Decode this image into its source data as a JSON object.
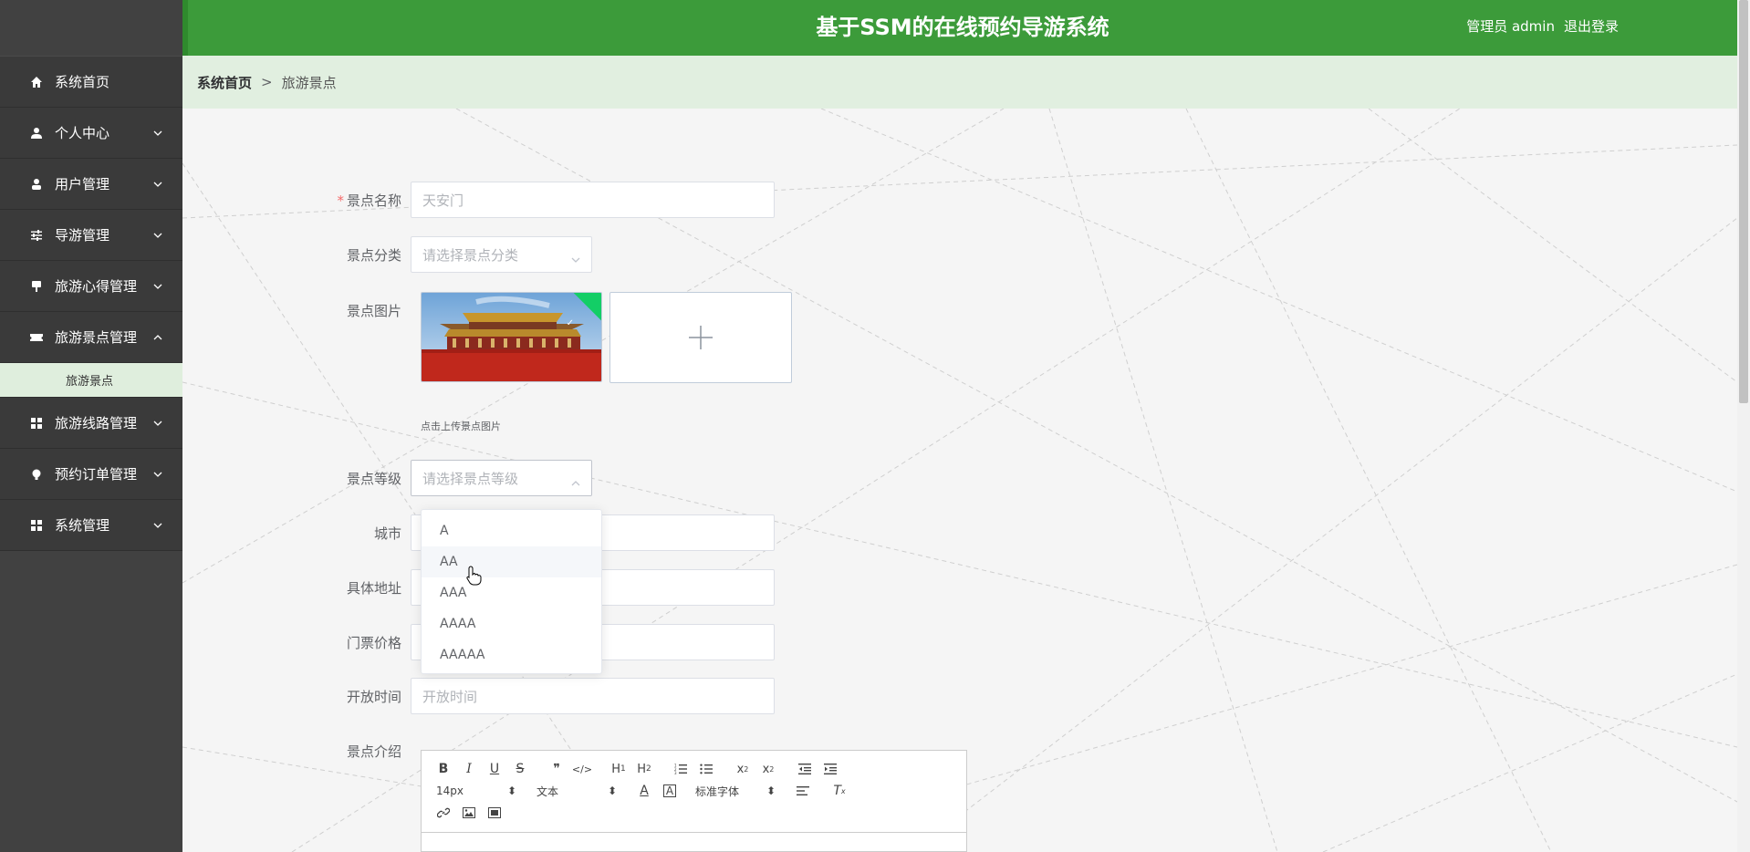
{
  "header": {
    "title": "基于SSM的在线预约导游系统",
    "user_label": "管理员 admin",
    "logout_label": "退出登录"
  },
  "sidebar": {
    "items": [
      {
        "label": "系统首页",
        "icon": "home-icon",
        "expandable": false
      },
      {
        "label": "个人中心",
        "icon": "user-icon",
        "expandable": true
      },
      {
        "label": "用户管理",
        "icon": "user-manage-icon",
        "expandable": true
      },
      {
        "label": "导游管理",
        "icon": "sliders-icon",
        "expandable": true
      },
      {
        "label": "旅游心得管理",
        "icon": "sign-icon",
        "expandable": true
      },
      {
        "label": "旅游景点管理",
        "icon": "ticket-icon",
        "expandable": true,
        "expanded": true
      },
      {
        "label": "旅游线路管理",
        "icon": "grid-icon",
        "expandable": true
      },
      {
        "label": "预约订单管理",
        "icon": "bulb-icon",
        "expandable": true
      },
      {
        "label": "系统管理",
        "icon": "grid-icon",
        "expandable": true
      }
    ],
    "submenu": {
      "label": "旅游景点"
    }
  },
  "breadcrumb": {
    "home": "系统首页",
    "separator": ">",
    "current": "旅游景点"
  },
  "form": {
    "name": {
      "label": "景点名称",
      "required": "*",
      "placeholder": "天安门"
    },
    "category": {
      "label": "景点分类",
      "placeholder": "请选择景点分类"
    },
    "image": {
      "label": "景点图片",
      "hint": "点击上传景点图片"
    },
    "level": {
      "label": "景点等级",
      "placeholder": "请选择景点等级",
      "open": true
    },
    "city": {
      "label": "城市"
    },
    "address": {
      "label": "具体地址"
    },
    "price": {
      "label": "门票价格"
    },
    "open_time": {
      "label": "开放时间",
      "placeholder": "开放时间"
    },
    "intro": {
      "label": "景点介绍"
    }
  },
  "level_options": [
    "A",
    "AA",
    "AAA",
    "AAAA",
    "AAAAA"
  ],
  "hovered_option_index": 1,
  "editor": {
    "row1": [
      "B",
      "I",
      "U",
      "S",
      "quote",
      "code",
      "H1",
      "H2",
      "ol",
      "ul",
      "sub",
      "sup",
      "outdent",
      "indent"
    ],
    "font_size": "14px",
    "text_type": "文本",
    "font_family": "标准字体"
  },
  "colors": {
    "header": "#3c9b3a",
    "sidebar": "#414141",
    "breadcrumb": "#e1efe0",
    "submenu": "#dfeedd",
    "required": "#f56c6c"
  }
}
